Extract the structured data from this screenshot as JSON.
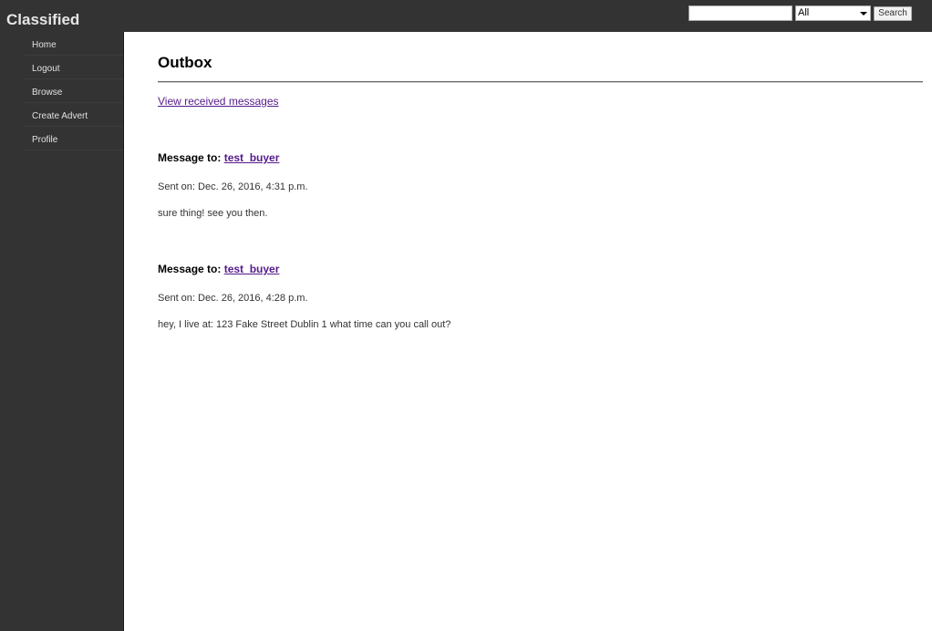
{
  "header": {
    "brand": "Classified",
    "search": {
      "value": "",
      "placeholder": "",
      "category_selected": "All",
      "button_label": "Search"
    }
  },
  "sidebar": {
    "items": [
      {
        "label": "Home"
      },
      {
        "label": "Logout"
      },
      {
        "label": "Browse"
      },
      {
        "label": "Create Advert"
      },
      {
        "label": "Profile"
      }
    ]
  },
  "main": {
    "title": "Outbox",
    "view_received_label": "View received messages",
    "messages": [
      {
        "to_label": "Message to:",
        "recipient": "test_buyer",
        "sent": "Sent on: Dec. 26, 2016, 4:31 p.m.",
        "body": "sure thing! see you then."
      },
      {
        "to_label": "Message to:",
        "recipient": "test_buyer",
        "sent": "Sent on: Dec. 26, 2016, 4:28 p.m.",
        "body": "hey, I live at: 123 Fake Street Dublin 1 what time can you call out?"
      }
    ]
  },
  "colors": {
    "chrome_background": "#333333",
    "content_background": "#ffffff",
    "link_visited": "#551a8b"
  }
}
